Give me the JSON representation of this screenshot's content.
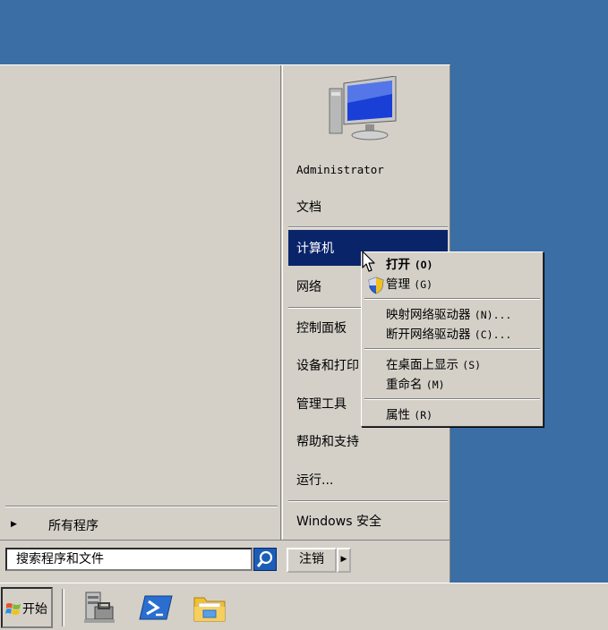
{
  "start_menu": {
    "user_name": "Administrator",
    "right_items": {
      "documents": "文档",
      "computer": "计算机",
      "network": "网络",
      "control_panel": "控制面板",
      "devices_printers": "设备和打印",
      "admin_tools": "管理工具",
      "help_support": "帮助和支持",
      "run": "运行...",
      "windows_security": "Windows 安全"
    },
    "all_programs": "所有程序",
    "search_placeholder": "搜索程序和文件",
    "logoff_label": "注销"
  },
  "context_menu": {
    "items": [
      {
        "label": "打开",
        "accel": "(O)"
      },
      {
        "label": "管理",
        "accel": "(G)"
      },
      {
        "label": "映射网络驱动器",
        "accel": "(N)..."
      },
      {
        "label": "断开网络驱动器",
        "accel": "(C)..."
      },
      {
        "label": "在桌面上显示",
        "accel": "(S)"
      },
      {
        "label": "重命名",
        "accel": "(M)"
      },
      {
        "label": "属性",
        "accel": "(R)"
      }
    ]
  },
  "taskbar": {
    "start_label": "开始",
    "pinned": [
      "server-manager-icon",
      "powershell-icon",
      "explorer-folder-icon"
    ]
  },
  "colors": {
    "desktop": "#3a6ea5",
    "menu_bg": "#d4d0c8",
    "highlight": "#0a246a"
  }
}
